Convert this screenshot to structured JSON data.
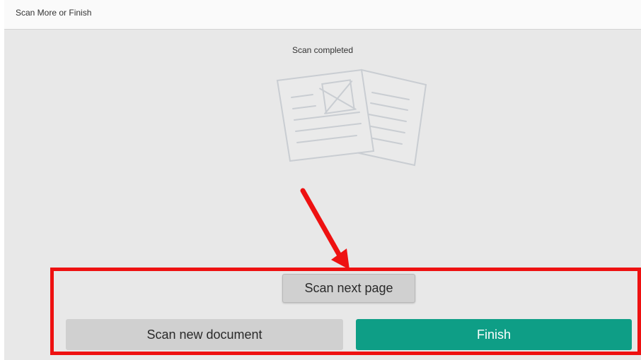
{
  "window": {
    "title": "Scan More or Finish"
  },
  "main": {
    "status_text": "Scan completed",
    "illustration_icon": "scanned-documents-icon"
  },
  "actions": {
    "scan_next_label": "Scan next page",
    "scan_new_label": "Scan new document",
    "finish_label": "Finish"
  },
  "annotation": {
    "color": "#ee1111"
  },
  "colors": {
    "finish_button": "#0e9e86",
    "secondary_button": "#d0d0d0",
    "background": "#e8e8e8"
  }
}
